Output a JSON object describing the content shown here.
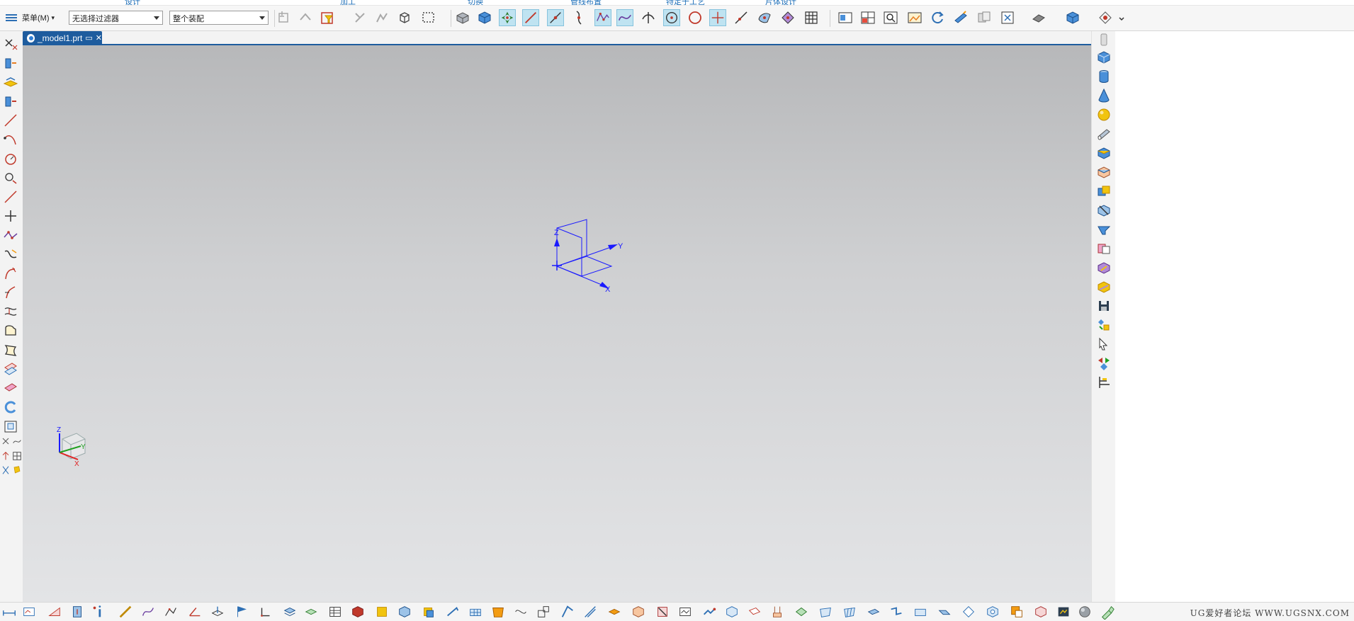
{
  "ribbon_groups": [
    "设计",
    "加工",
    "切换",
    "管线布置",
    "特定于工艺",
    "片体设计"
  ],
  "toolbar": {
    "menu_label": "菜单(M)",
    "menu_arrow": "▾",
    "selection_filter": "无选择过滤器",
    "assembly_scope": "整个装配"
  },
  "tab": {
    "title": "_model1.prt",
    "close_glyph": "✕"
  },
  "viewport": {
    "axis_x": "X",
    "axis_y": "Y",
    "axis_z": "Z",
    "triad_x": "X",
    "triad_y": "Y",
    "triad_z": "Z",
    "csys_color": "#1a1aff"
  },
  "bottom": {
    "watermark": "UG爱好者论坛 WWW.UGSNX.COM"
  },
  "colors": {
    "accent": "#1e5c9e",
    "active_tool": "#bfe3f1"
  }
}
